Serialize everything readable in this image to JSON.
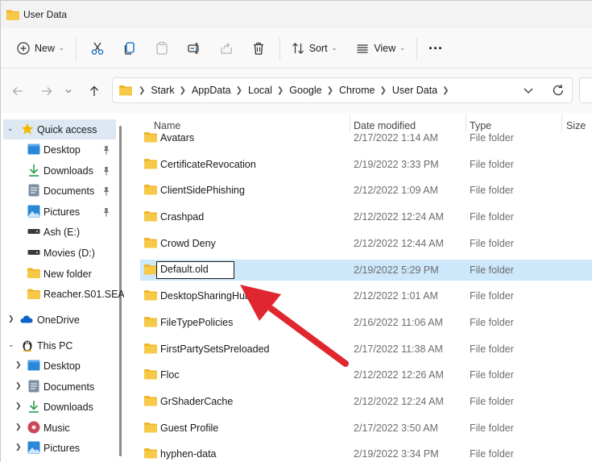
{
  "window": {
    "title": "User Data"
  },
  "toolbar": {
    "new_label": "New",
    "sort_label": "Sort",
    "view_label": "View",
    "more_label": "..."
  },
  "address": {
    "crumbs": [
      "Stark",
      "AppData",
      "Local",
      "Google",
      "Chrome",
      "User Data"
    ]
  },
  "sidebar": {
    "quick_access": "Quick access",
    "quick_items": [
      "Desktop",
      "Downloads",
      "Documents",
      "Pictures",
      "Ash (E:)",
      "Movies (D:)",
      "New folder",
      "Reacher.S01.SEA"
    ],
    "onedrive": "OneDrive",
    "thispc": "This PC",
    "pc_items": [
      "Desktop",
      "Documents",
      "Downloads",
      "Music",
      "Pictures"
    ]
  },
  "columns": {
    "name": "Name",
    "date": "Date modified",
    "type": "Type",
    "size": "Size"
  },
  "files": [
    {
      "name": "Avatars",
      "date": "2/17/2022 1:14 AM",
      "type": "File folder"
    },
    {
      "name": "CertificateRevocation",
      "date": "2/19/2022 3:33 PM",
      "type": "File folder"
    },
    {
      "name": "ClientSidePhishing",
      "date": "2/12/2022 1:09 AM",
      "type": "File folder"
    },
    {
      "name": "Crashpad",
      "date": "2/12/2022 12:24 AM",
      "type": "File folder"
    },
    {
      "name": "Crowd Deny",
      "date": "2/12/2022 12:44 AM",
      "type": "File folder"
    },
    {
      "name": "Default.old",
      "date": "2/19/2022 5:29 PM",
      "type": "File folder"
    },
    {
      "name": "DesktopSharingHub",
      "date": "2/12/2022 1:01 AM",
      "type": "File folder"
    },
    {
      "name": "FileTypePolicies",
      "date": "2/16/2022 11:06 AM",
      "type": "File folder"
    },
    {
      "name": "FirstPartySetsPreloaded",
      "date": "2/17/2022 11:38 AM",
      "type": "File folder"
    },
    {
      "name": "Floc",
      "date": "2/12/2022 12:26 AM",
      "type": "File folder"
    },
    {
      "name": "GrShaderCache",
      "date": "2/12/2022 12:24 AM",
      "type": "File folder"
    },
    {
      "name": "Guest Profile",
      "date": "2/17/2022 3:50 AM",
      "type": "File folder"
    },
    {
      "name": "hyphen-data",
      "date": "2/19/2022 3:34 PM",
      "type": "File folder"
    }
  ],
  "colors": {
    "selection": "#cde8fb",
    "folder": "#f7c948",
    "arrow": "#e0262f",
    "accent": "#0067c0"
  }
}
